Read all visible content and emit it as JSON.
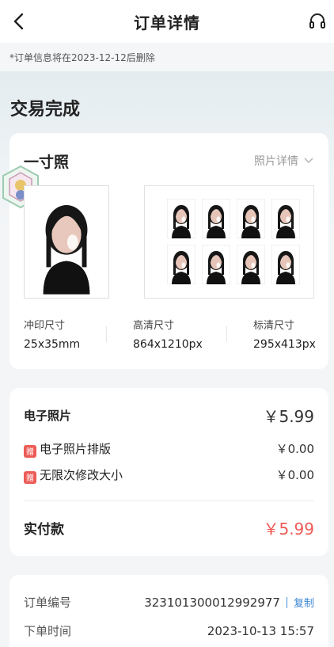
{
  "header": {
    "title": "订单详情",
    "back_icon": "chevron-left-icon",
    "service_icon": "headset-icon"
  },
  "notice": "*订单信息将在2023-12-12后删除",
  "status": "交易完成",
  "photo_card": {
    "title": "一寸照",
    "detail_label": "照片详情",
    "sizes": [
      {
        "label": "冲印尺寸",
        "value": "25x35mm"
      },
      {
        "label": "高清尺寸",
        "value": "864x1210px"
      },
      {
        "label": "标清尺寸",
        "value": "295x413px"
      }
    ]
  },
  "price_card": {
    "item_label": "电子照片",
    "item_price": "￥5.99",
    "gift_badge": "赠",
    "gifts": [
      {
        "label": "电子照片排版",
        "price": "￥0.00"
      },
      {
        "label": "无限次修改大小",
        "price": "￥0.00"
      }
    ],
    "paid_label": "实付款",
    "paid_value": "￥5.99"
  },
  "order_card": {
    "order_no_label": "订单编号",
    "order_no": "323101300012992977",
    "copy_label": "复制",
    "time_label": "下单时间",
    "time": "2023-10-13 15:57"
  },
  "colors": {
    "accent_red": "#ec5b56",
    "link_blue": "#3a85d4"
  }
}
